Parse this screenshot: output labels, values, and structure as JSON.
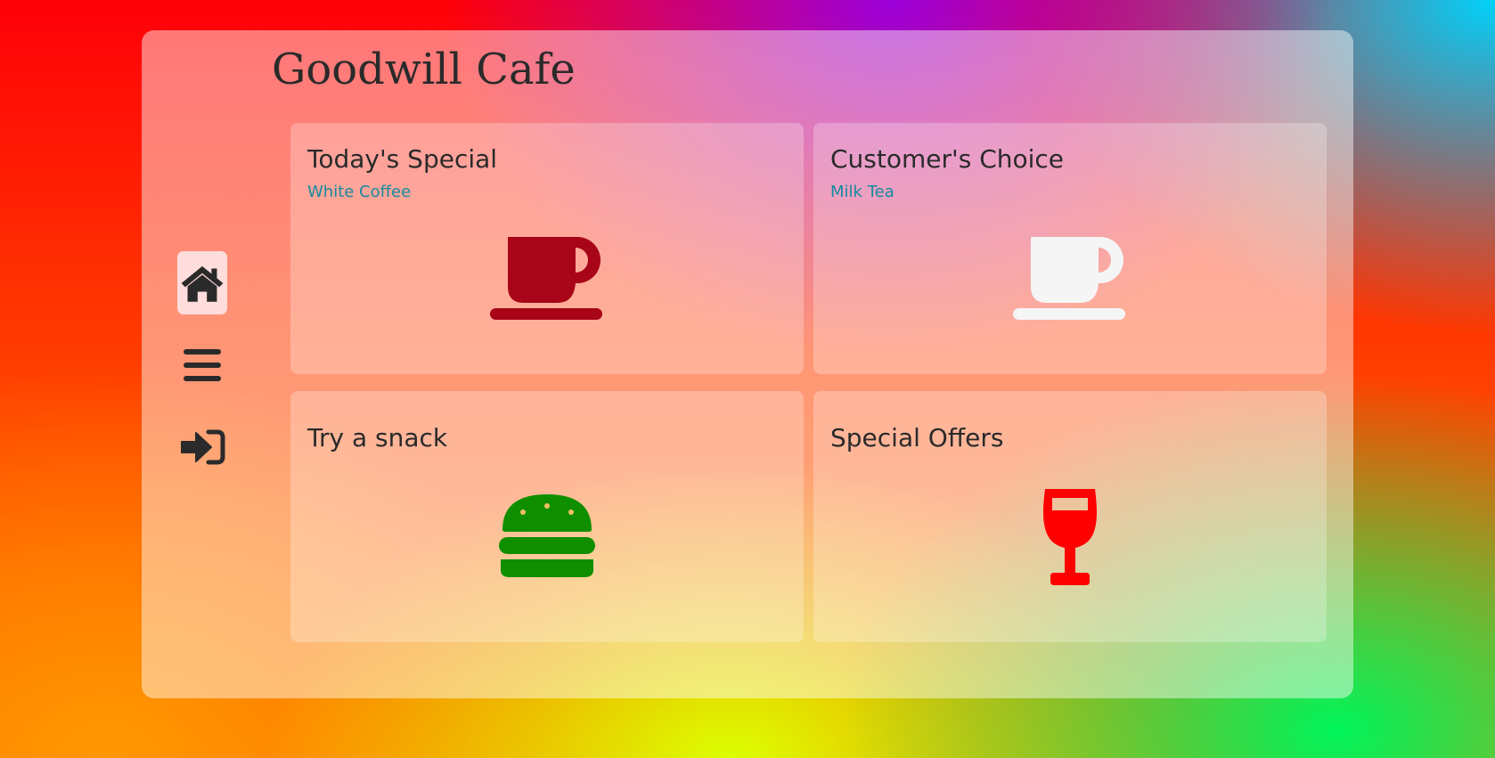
{
  "app": {
    "title": "Goodwill Cafe"
  },
  "sidebar": {
    "items": [
      {
        "name": "home",
        "icon": "home-icon",
        "active": true
      },
      {
        "name": "menu",
        "icon": "menu-bars-icon",
        "active": false
      },
      {
        "name": "login",
        "icon": "sign-in-icon",
        "active": false
      }
    ],
    "active_bg": "#ffe1e1",
    "icon_color": "#2a2a2a"
  },
  "cards": [
    {
      "title": "Today's Special",
      "subtitle": "White Coffee",
      "icon": "coffee-cup-icon",
      "icon_color": "#a80518"
    },
    {
      "title": "Customer's Choice",
      "subtitle": "Milk Tea",
      "icon": "coffee-cup-icon",
      "icon_color": "#f5f5f5"
    },
    {
      "title": "Try a snack",
      "icon": "burger-icon",
      "icon_color": "#0f8f00"
    },
    {
      "title": "Special Offers",
      "icon": "wine-glass-icon",
      "icon_color": "#ff0000"
    }
  ],
  "colors": {
    "title_text": "#2a2a2a",
    "subtitle_text": "#168aa0"
  }
}
